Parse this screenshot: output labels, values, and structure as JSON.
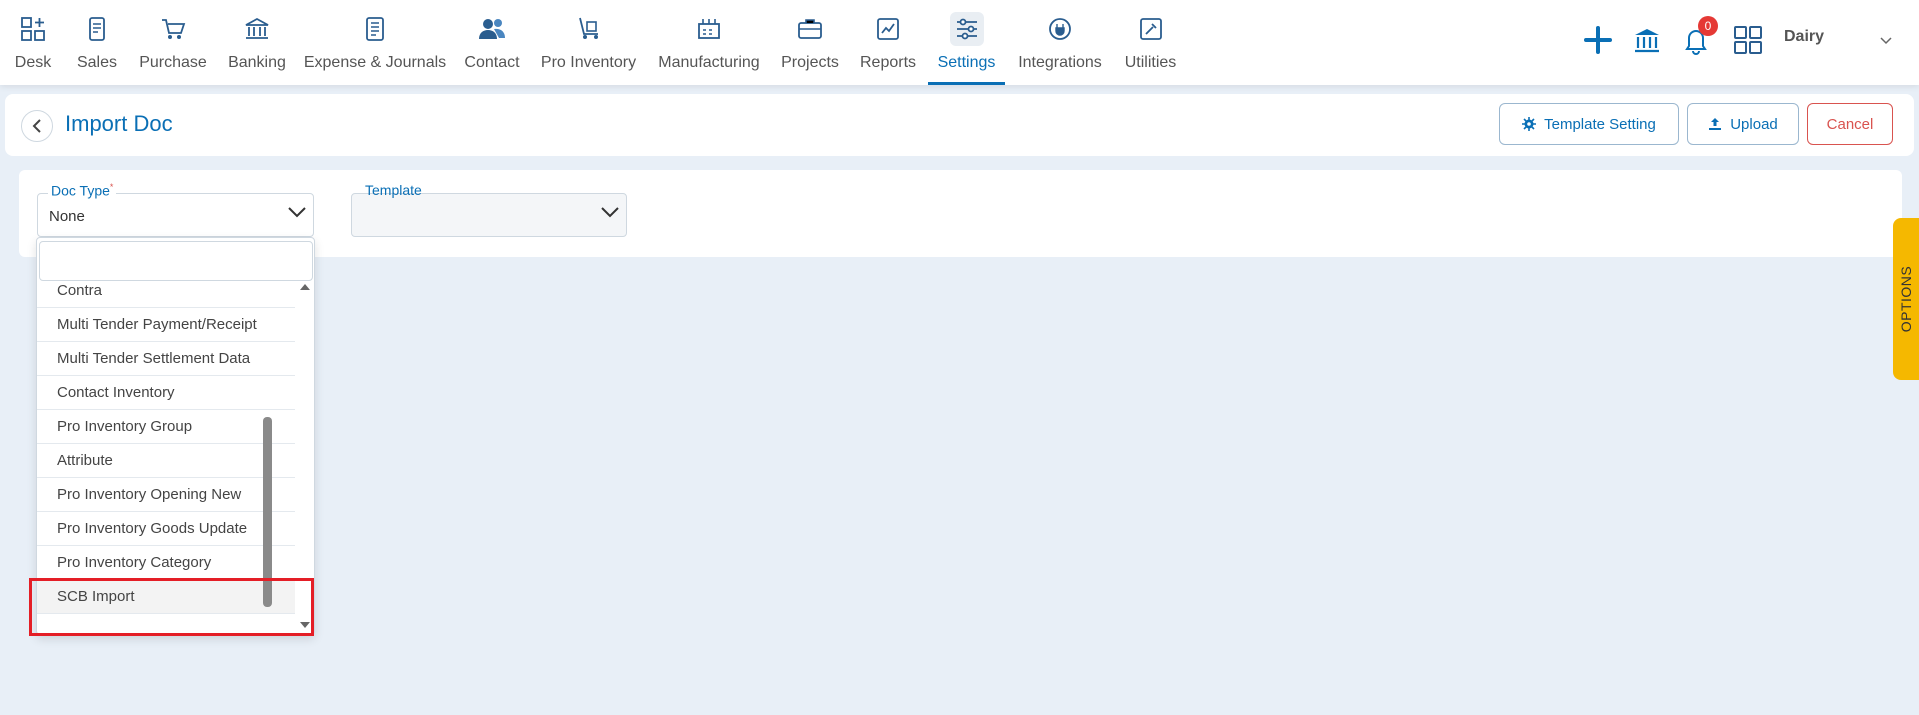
{
  "nav": {
    "items": [
      {
        "label": "Desk",
        "icon": "grid-plus-icon"
      },
      {
        "label": "Sales",
        "icon": "receipt-icon"
      },
      {
        "label": "Purchase",
        "icon": "cart-icon"
      },
      {
        "label": "Banking",
        "icon": "bank-icon"
      },
      {
        "label": "Expense & Journals",
        "icon": "journal-icon"
      },
      {
        "label": "Contact",
        "icon": "contacts-icon"
      },
      {
        "label": "Pro Inventory",
        "icon": "trolley-icon"
      },
      {
        "label": "Manufacturing",
        "icon": "factory-icon"
      },
      {
        "label": "Projects",
        "icon": "briefcase-icon"
      },
      {
        "label": "Reports",
        "icon": "report-chart-icon"
      },
      {
        "label": "Settings",
        "icon": "sliders-icon"
      },
      {
        "label": "Integrations",
        "icon": "plug-icon"
      },
      {
        "label": "Utilities",
        "icon": "tools-icon"
      }
    ],
    "active": "Settings",
    "notifications_count": "0",
    "company_name": "Dairy"
  },
  "header": {
    "title": "Import Doc",
    "template_setting_label": "Template Setting",
    "upload_label": "Upload",
    "cancel_label": "Cancel"
  },
  "form": {
    "doc_type_label": "Doc Type",
    "doc_type_required": "*",
    "doc_type_value": "None",
    "template_label": "Template",
    "template_value": ""
  },
  "dropdown": {
    "search_placeholder": "",
    "items": [
      "Contra",
      "Multi Tender Payment/Receipt",
      "Multi Tender Settlement Data",
      "Contact Inventory",
      "Pro Inventory Group",
      "Attribute",
      "Pro Inventory Opening New",
      "Pro Inventory Goods Update",
      "Pro Inventory Category",
      "SCB Import"
    ],
    "highlighted": "SCB Import"
  },
  "options_tab": {
    "label": "OPTIONS"
  },
  "colors": {
    "accent": "#0a6fb5",
    "cancel": "#d9534f",
    "options": "#f5b800",
    "highlight": "#e41e26",
    "background": "#e8eff7"
  }
}
